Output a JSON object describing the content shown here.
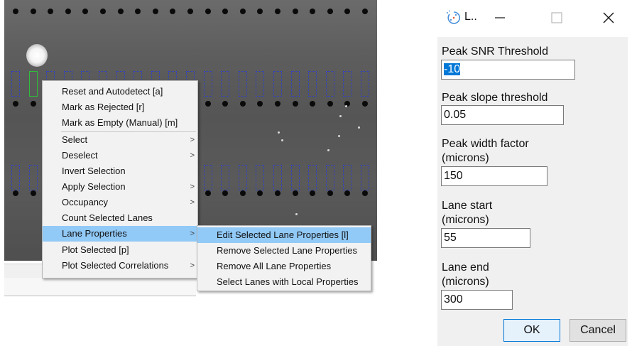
{
  "context_menu": {
    "items": [
      {
        "label": "Reset and Autodetect [a]",
        "submenu": false
      },
      {
        "label": "Mark as Rejected [r]",
        "submenu": false
      },
      {
        "label": "Mark as Empty (Manual) [m]",
        "submenu": false
      },
      {
        "label": "Select",
        "submenu": true
      },
      {
        "label": "Deselect",
        "submenu": true
      },
      {
        "label": "Invert Selection",
        "submenu": false
      },
      {
        "label": "Apply Selection",
        "submenu": true
      },
      {
        "label": "Occupancy",
        "submenu": true
      },
      {
        "label": "Count Selected Lanes",
        "submenu": false
      },
      {
        "label": "Lane Properties",
        "submenu": true,
        "highlighted": true
      },
      {
        "label": "Plot Selected [p]",
        "submenu": false
      },
      {
        "label": "Plot Selected Correlations",
        "submenu": true
      }
    ],
    "arrow": ">"
  },
  "lane_properties_submenu": {
    "items": [
      {
        "label": "Edit Selected Lane Properties [l]",
        "highlighted": true
      },
      {
        "label": "Remove Selected Lane Properties"
      },
      {
        "label": "Remove All Lane Properties"
      },
      {
        "label": "Select Lanes with Local Properties"
      }
    ]
  },
  "dialog": {
    "title": "L..",
    "icon": "lane-app-icon",
    "fields": [
      {
        "label": "Peak SNR Threshold",
        "value": "-10",
        "selected": true
      },
      {
        "label": "Peak slope threshold",
        "value": "0.05"
      },
      {
        "label_line1": "Peak width factor",
        "label_line2": "(microns)",
        "value": "150"
      },
      {
        "label_line1": "Lane start",
        "label_line2": "(microns)",
        "value": "55"
      },
      {
        "label_line1": "Lane end",
        "label_line2": "(microns)",
        "value": "300"
      }
    ],
    "ok_label": "OK",
    "cancel_label": "Cancel"
  },
  "colors": {
    "menu_highlight": "#91c9f7",
    "selection": "#0078d7",
    "lane_box": "#2b3fd0",
    "lane_box_selected": "#2fbf3a"
  }
}
